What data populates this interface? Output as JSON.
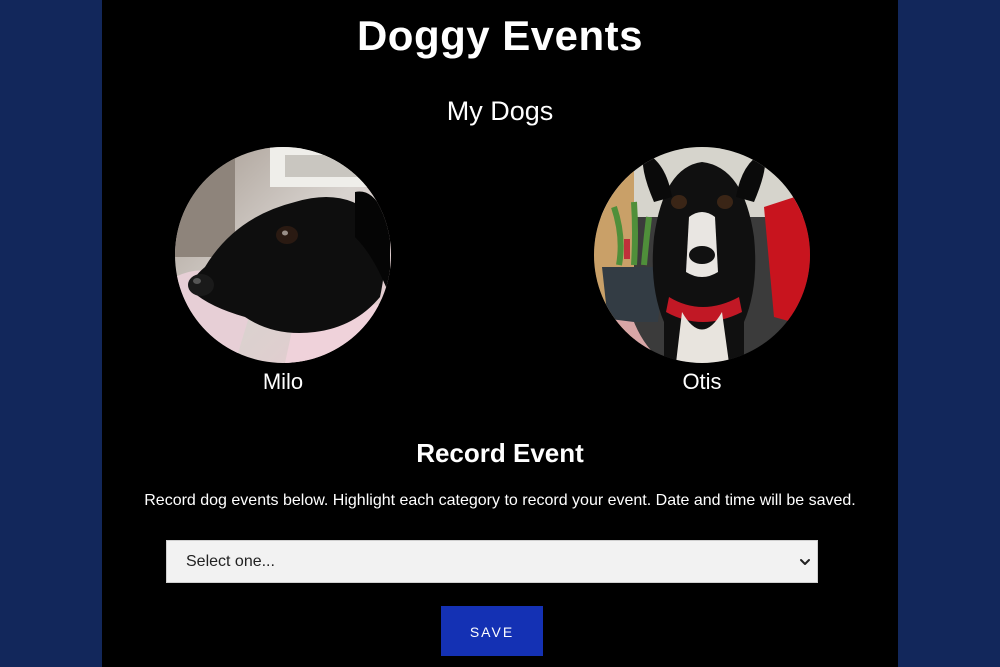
{
  "header": {
    "title": "Doggy Events"
  },
  "dogs_section": {
    "title": "My Dogs",
    "dogs": [
      {
        "name": "Milo",
        "photo_icon": "black-dog-photo"
      },
      {
        "name": "Otis",
        "photo_icon": "black-white-dog-photo"
      }
    ]
  },
  "record_section": {
    "title": "Record Event",
    "description": "Record dog events below. Highlight each category to record your event. Date and time will be saved.",
    "select": {
      "selected": "Select one..."
    },
    "save_label": "SAVE"
  },
  "colors": {
    "outer_background": "#12275b",
    "page_background": "#000000",
    "save_button": "#1431b4",
    "select_background": "#f2f2f2"
  }
}
